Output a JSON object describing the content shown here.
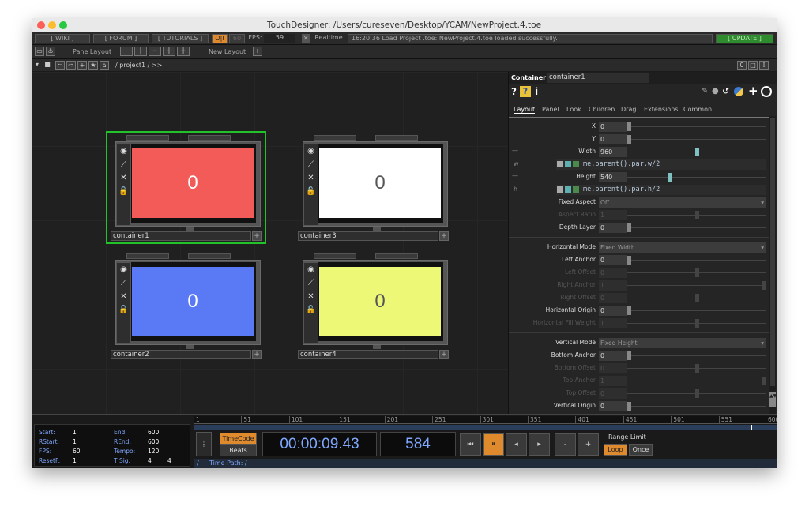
{
  "window": {
    "title": "TouchDesigner: /Users/cureseven/Desktop/YCAM/NewProject.4.toe"
  },
  "menubar": {
    "wiki": "[ WIKI ]",
    "forum": "[ FORUM ]",
    "tutorials": "[ TUTORIALS ]",
    "pause_label": "O|I",
    "fps_target": "60",
    "fps_label": "FPS:",
    "fps_value": "59",
    "realtime_label": "Realtime",
    "status_message": "16:20:36 Load Project .toe: NewProject.4.toe loaded successfully.",
    "update_label": "[ UPDATE ]"
  },
  "layoutbar": {
    "pane_layout": "Pane Layout",
    "new_layout": "New Layout",
    "plus": "+"
  },
  "pathbar": {
    "path": "/ project1 / >>",
    "right_value": "0"
  },
  "nodes": [
    {
      "name": "container1",
      "value": "0",
      "color": "#f25b58",
      "text_color": "#ffffff",
      "selected": true
    },
    {
      "name": "container3",
      "value": "0",
      "color": "#ffffff",
      "text_color": "#555555",
      "selected": false
    },
    {
      "name": "container2",
      "value": "0",
      "color": "#5a7af5",
      "text_color": "#ffffff",
      "selected": false
    },
    {
      "name": "container4",
      "value": "0",
      "color": "#eef877",
      "text_color": "#555555",
      "selected": false
    }
  ],
  "params": {
    "op_type": "Container",
    "op_name": "container1",
    "tabs": [
      "Layout",
      "Panel",
      "Look",
      "Children",
      "Drag",
      "Extensions",
      "Common"
    ],
    "x_label": "X",
    "x_value": "0",
    "y_label": "Y",
    "y_value": "0",
    "width_label": "Width",
    "width_value": "960",
    "width_fraction": 0.49,
    "width_expr": "me.parent().par.w/2",
    "width_expr_tag": "w",
    "height_label": "Height",
    "height_value": "540",
    "height_fraction": 0.29,
    "height_expr": "me.parent().par.h/2",
    "height_expr_tag": "h",
    "dash": "—",
    "fixed_aspect_label": "Fixed Aspect",
    "fixed_aspect_value": "Off",
    "aspect_ratio_label": "Aspect Ratio",
    "aspect_ratio_value": "1",
    "depth_layer_label": "Depth Layer",
    "depth_layer_value": "0",
    "horizontal_mode_label": "Horizontal Mode",
    "horizontal_mode_value": "Fixed Width",
    "left_anchor_label": "Left Anchor",
    "left_anchor_value": "0",
    "left_offset_label": "Left Offset",
    "left_offset_value": "0",
    "right_anchor_label": "Right Anchor",
    "right_anchor_value": "1",
    "right_offset_label": "Right Offset",
    "right_offset_value": "0",
    "horizontal_origin_label": "Horizontal Origin",
    "horizontal_origin_value": "0",
    "horizontal_fill_weight_label": "Horizontal Fill Weight",
    "horizontal_fill_weight_value": "1",
    "vertical_mode_label": "Vertical Mode",
    "vertical_mode_value": "Fixed Height",
    "bottom_anchor_label": "Bottom Anchor",
    "bottom_anchor_value": "0",
    "bottom_offset_label": "Bottom Offset",
    "bottom_offset_value": "0",
    "top_anchor_label": "Top Anchor",
    "top_anchor_value": "1",
    "top_offset_label": "Top Offset",
    "top_offset_value": "0",
    "vertical_origin_label": "Vertical Origin",
    "vertical_origin_value": "0"
  },
  "timeline": {
    "start_label": "Start:",
    "start": "1",
    "end_label": "End:",
    "end": "600",
    "rstart_label": "RStart:",
    "rstart": "1",
    "rend_label": "REnd:",
    "rend": "600",
    "fps_label": "FPS:",
    "fps": "60",
    "tempo_label": "Tempo:",
    "tempo": "120",
    "resetf_label": "ResetF:",
    "resetf": "1",
    "tsig_label": "T Sig:",
    "tsig_a": "4",
    "tsig_b": "4",
    "ruler_ticks": [
      "1",
      "51",
      "101",
      "151",
      "201",
      "251",
      "301",
      "351",
      "401",
      "451",
      "501",
      "551",
      "600"
    ],
    "timecode_label": "TimeCode",
    "beats_label": "Beats",
    "timecode": "00:00:09.43",
    "frame": "584",
    "range_limit_label": "Range Limit",
    "loop_label": "Loop",
    "once_label": "Once",
    "time_path": "Time Path: /"
  },
  "colors": {
    "selection": "#22c22a",
    "accent_orange": "#e08a2e",
    "update_green": "#2e8b2e"
  }
}
